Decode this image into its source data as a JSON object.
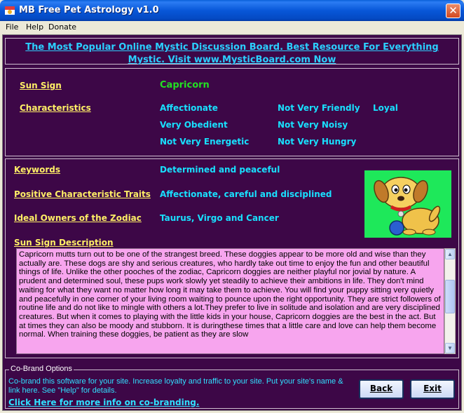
{
  "window": {
    "title": "MB Free Pet Astrology v1.0",
    "close_glyph": "✕"
  },
  "menu": {
    "file": "File",
    "help": "Help",
    "donate": "Donate"
  },
  "banner": "The Most Popular Online Mystic Discussion Board. Best Resource For Everything Mystic. Visit www.MysticBoard.com Now",
  "sun_sign": {
    "label": "Sun Sign",
    "value": "Capricorn"
  },
  "characteristics": {
    "label": "Characteristics",
    "items": [
      "Affectionate",
      "Not Very Friendly",
      "Loyal",
      "Very Obedient",
      "Not Very Noisy",
      "Not Very Energetic",
      "Not Very Hungry"
    ]
  },
  "keywords": {
    "label": "Keywords",
    "value": "Determined and peaceful"
  },
  "positive_traits": {
    "label": "Positive Characteristic Traits",
    "value": "Affectionate, careful and disciplined"
  },
  "ideal_owners": {
    "label": "Ideal Owners of the Zodiac",
    "value": "Taurus, Virgo and Cancer"
  },
  "description": {
    "label": "Sun Sign Description",
    "text": "Capricorn mutts turn out to be one of the strangest breed. These doggies appear to be more old and wise than they actually are. These dogs are shy and serious creatures, who hardly take out time to enjoy the fun and other beautiful things of life. Unlike the other pooches of the zodiac, Capricorn doggies are neither playful nor jovial by nature. A prudent and determined soul, these pups work slowly yet steadily to achieve their ambitions in life. They don't mind waiting for what they want no matter how long it may take them to achieve. You will find your puppy sitting very quietly and peacefully in one corner of your living room waiting to pounce upon the right opportunity. They are strict followers of routine life and do not like to mingle with others a lot.They prefer to live in solitude and isolation and are very disciplined creatures. But when it comes to playing with the little kids in your house, Capricorn doggies are the best in the act. But at times they can also be moody and stubborn. It is duringthese times that a little care and love can help them become normal. When training these doggies, be patient as they are slow"
  },
  "cobrand": {
    "legend": "Co-Brand Options",
    "text": "Co-brand this software for your site.  Increase loyalty and traffic to your site. Put your site's name &  link here. See \"Help\" for details.",
    "link": "Click Here for more info on co-branding."
  },
  "buttons": {
    "back": "Back",
    "exit": "Exit"
  },
  "colors": {
    "background": "#3d0747",
    "label": "#ffef66",
    "value": "#18e0ff",
    "sign": "#22e022",
    "description_bg": "#f7a5ee",
    "image_bg": "#1ee85a"
  }
}
